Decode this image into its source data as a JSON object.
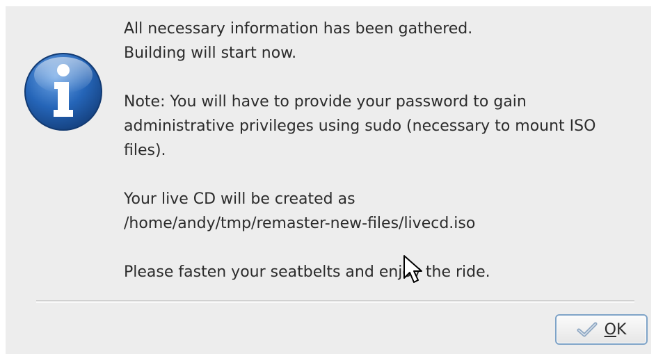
{
  "dialog": {
    "messages": [
      "All necessary information has been gathered.\nBuilding will start now.",
      "Note: You will have to provide your password to gain\nadministrative privileges using sudo (necessary to mount ISO\nfiles).",
      "Your live CD will be created as\n/home/andy/tmp/remaster-new-files/livecd.iso",
      "Please fasten your seatbelts and enjoy the ride."
    ],
    "icon": "info-icon",
    "ok_button": {
      "mnemonic": "O",
      "rest": "K",
      "icon": "checkmark-icon"
    }
  },
  "colors": {
    "background": "#ededed",
    "icon_blue": "#1f5aa6",
    "button_border": "#7ea3c7",
    "text": "#2b2b2b"
  }
}
